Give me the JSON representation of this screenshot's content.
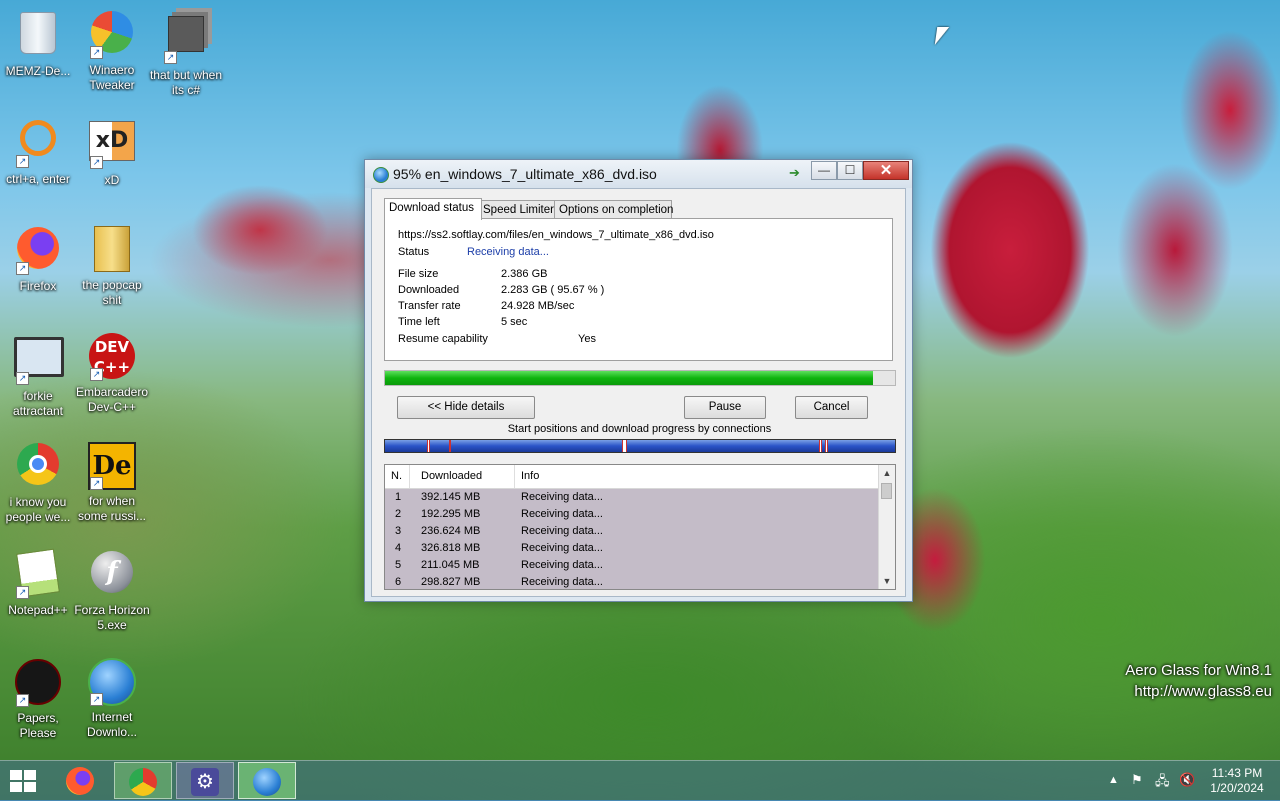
{
  "desktop": {
    "icons": [
      {
        "label": "MEMZ-De...",
        "icon": "recycle-bin-icon"
      },
      {
        "label": "Winaero Tweaker",
        "icon": "winaero-icon"
      },
      {
        "label": "that but when its c#",
        "icon": "stacked-windows-icon"
      },
      {
        "label": "ctrl+a, enter",
        "icon": "search-icon"
      },
      {
        "label": "xD",
        "icon": "hxd-icon"
      },
      {
        "label": "Firefox",
        "icon": "firefox-icon"
      },
      {
        "label": "the popcap shit",
        "icon": "folder-icon"
      },
      {
        "label": "forkie attractant",
        "icon": "monitor-settings-icon"
      },
      {
        "label": "Embarcadero Dev-C++",
        "icon": "devcpp-icon"
      },
      {
        "label": "i know you people we...",
        "icon": "chrome-icon"
      },
      {
        "label": "for when some russi...",
        "icon": "de-icon"
      },
      {
        "label": "Notepad++",
        "icon": "notepadpp-icon"
      },
      {
        "label": "Forza Horizon 5.exe",
        "icon": "flash-icon"
      },
      {
        "label": "Papers, Please",
        "icon": "papers-please-icon"
      },
      {
        "label": "Internet Downlo...",
        "icon": "idm-icon"
      }
    ],
    "dev_icon_text": "DEV C++",
    "hxd_icon_text": "xD",
    "de_icon_text": "De",
    "flash_icon_text": "f",
    "watermark": {
      "line1": "Aero Glass for Win8.1",
      "line2": "http://www.glass8.eu"
    }
  },
  "window": {
    "title": "95% en_windows_7_ultimate_x86_dvd.iso",
    "controls": {
      "minimize": "—",
      "maximize": "☐",
      "close": "✕"
    },
    "tabs": [
      {
        "label": "Download status",
        "active": true
      },
      {
        "label": "Speed Limiter",
        "active": false
      },
      {
        "label": "Options on completion",
        "active": false
      }
    ],
    "details": {
      "url": "https://ss2.softlay.com/files/en_windows_7_ultimate_x86_dvd.iso",
      "status_label": "Status",
      "status_value": "Receiving data...",
      "file_size_label": "File size",
      "file_size_value": "2.386  GB",
      "downloaded_label": "Downloaded",
      "downloaded_value": "2.283  GB  ( 95.67 % )",
      "transfer_rate_label": "Transfer rate",
      "transfer_rate_value": "24.928  MB/sec",
      "time_left_label": "Time left",
      "time_left_value": "5 sec",
      "resume_label": "Resume capability",
      "resume_value": "Yes"
    },
    "progress_percent": 95.67,
    "buttons": {
      "hide_details": "<< Hide details",
      "pause": "Pause",
      "cancel": "Cancel"
    },
    "connections_caption": "Start positions and download progress by connections",
    "connections_table": {
      "columns": [
        "N.",
        "Downloaded",
        "Info"
      ],
      "rows": [
        {
          "n": "1",
          "downloaded": "392.145  MB",
          "info": "Receiving data..."
        },
        {
          "n": "2",
          "downloaded": "192.295  MB",
          "info": "Receiving data..."
        },
        {
          "n": "3",
          "downloaded": "236.624  MB",
          "info": "Receiving data..."
        },
        {
          "n": "4",
          "downloaded": "326.818  MB",
          "info": "Receiving data..."
        },
        {
          "n": "5",
          "downloaded": "211.045  MB",
          "info": "Receiving data..."
        },
        {
          "n": "6",
          "downloaded": "298.827  MB",
          "info": "Receiving data..."
        }
      ]
    }
  },
  "taskbar": {
    "start_icon": "windows-logo-icon",
    "pinned": [
      "firefox-icon",
      "chrome-icon",
      "settings-icon",
      "idm-icon"
    ],
    "settings_glyph": "⚙",
    "tray": {
      "up_arrow": "▲",
      "flag": "⚑",
      "network": "🖧",
      "volume": "🔇"
    },
    "clock": {
      "time": "11:43 PM",
      "date": "1/20/2024"
    }
  }
}
